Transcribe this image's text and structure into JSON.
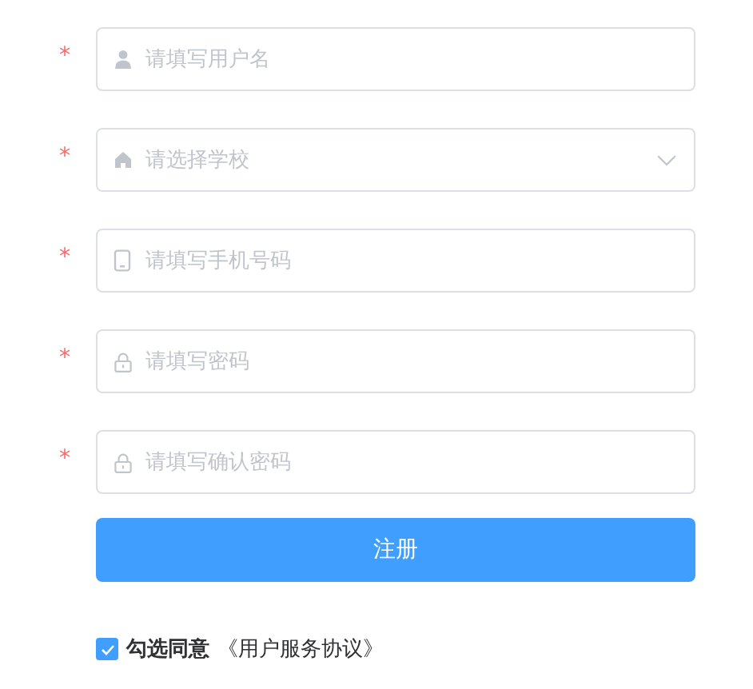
{
  "fields": [
    {
      "kind": "user",
      "placeholder": "请填写用户名",
      "required": true
    },
    {
      "kind": "school",
      "placeholder": "请选择学校",
      "required": true
    },
    {
      "kind": "phone",
      "placeholder": "请填写手机号码",
      "required": true
    },
    {
      "kind": "password",
      "placeholder": "请填写密码",
      "required": true
    },
    {
      "kind": "password",
      "placeholder": "请填写确认密码",
      "required": true
    }
  ],
  "required_mark": "*",
  "submit_button": "注册",
  "agreement": {
    "checked": true,
    "label": "勾选同意",
    "link": "《用户服务协议》"
  }
}
